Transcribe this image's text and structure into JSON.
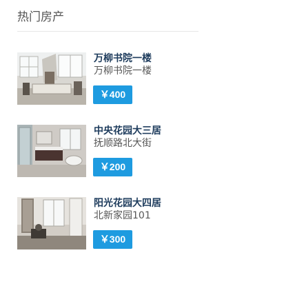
{
  "widget": {
    "title": "热门房产"
  },
  "properties": [
    {
      "name": "万柳书院一楼",
      "address": "万柳书院一楼",
      "price": "￥400",
      "photo_icon": "room-photo"
    },
    {
      "name": "中央花园大三居",
      "address": "抚顺路北大街",
      "price": "￥200",
      "photo_icon": "bathroom-photo"
    },
    {
      "name": "阳光花园大四居",
      "address": "北新家园101",
      "price": "￥300",
      "photo_icon": "room-photo"
    }
  ]
}
